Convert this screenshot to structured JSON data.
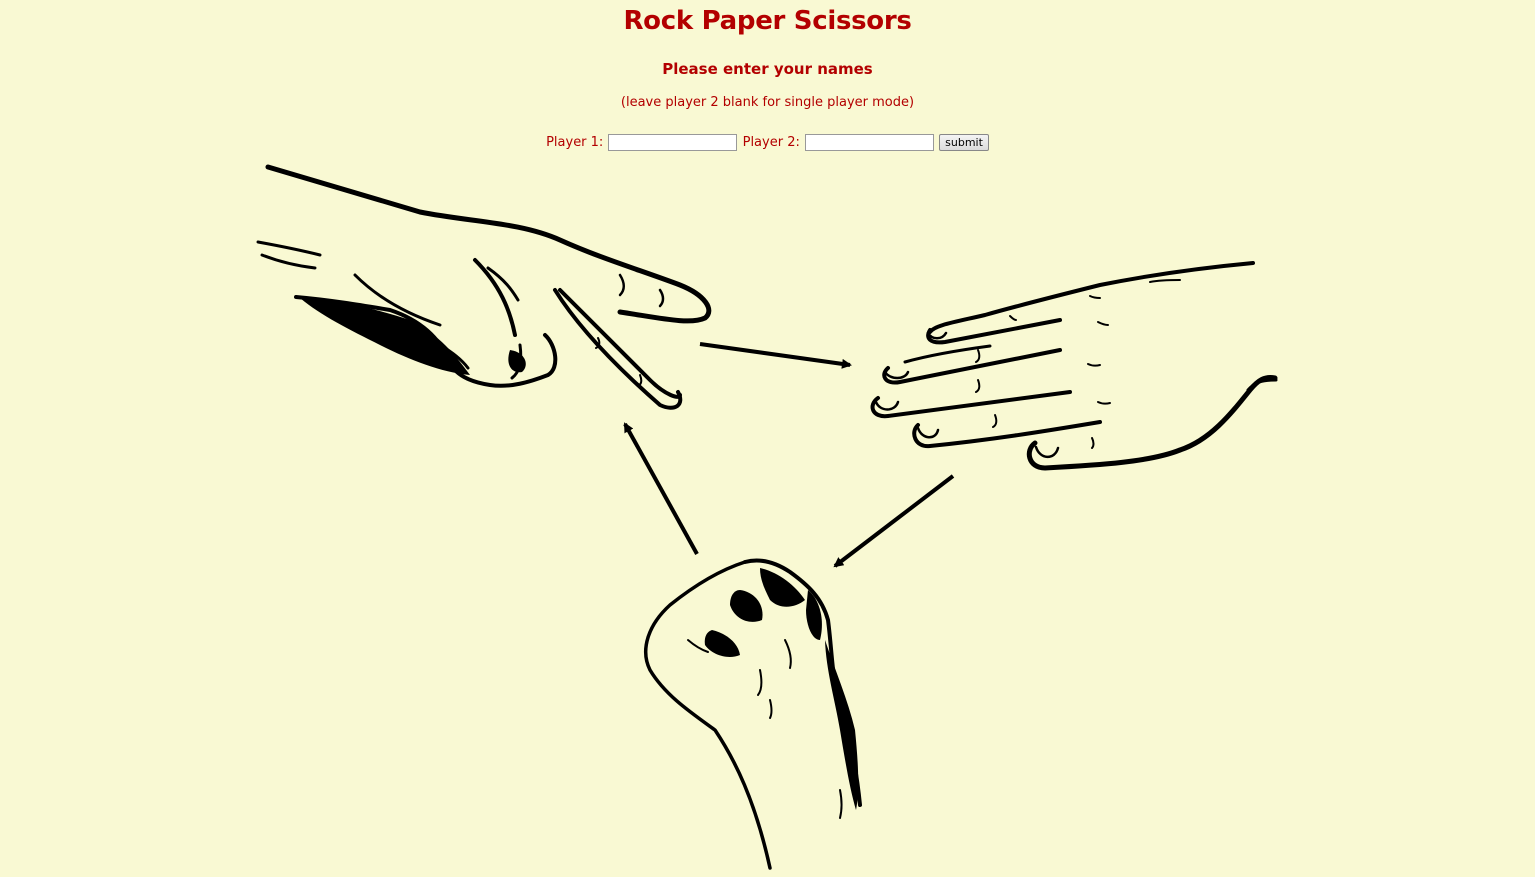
{
  "header": {
    "title": "Rock Paper Scissors",
    "subtitle": "Please enter your names",
    "hint": "(leave player 2 blank for single player mode)"
  },
  "form": {
    "player1_label": "Player 1:",
    "player1_value": "",
    "player2_label": "Player 2:",
    "player2_value": "",
    "submit_label": "submit"
  },
  "illustration": {
    "items": [
      "scissors-hand",
      "paper-hand",
      "rock-fist"
    ],
    "arrows": [
      "scissors-to-paper",
      "paper-to-rock",
      "rock-to-scissors"
    ]
  },
  "colors": {
    "background": "#f9f9d3",
    "text": "#b30000",
    "ink": "#000000"
  }
}
